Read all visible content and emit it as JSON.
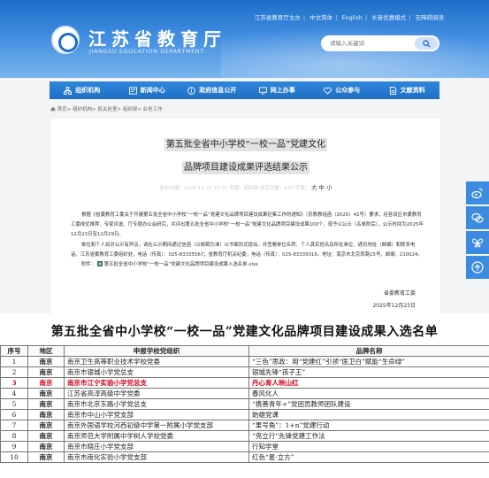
{
  "header": {
    "top_links": [
      "江苏省教育厅主办",
      "中文简体",
      "English",
      "长者优惠模式",
      "无障碍阅读"
    ],
    "site_title": "江苏省教育厅",
    "site_subtitle": "JIANGSU EDUCATION DEPARTMENT",
    "search_placeholder": "请输入关键词"
  },
  "nav": {
    "items": [
      {
        "label": "组织机构",
        "icon": "org-icon"
      },
      {
        "label": "新闻中心",
        "icon": "news-icon"
      },
      {
        "label": "政府信息公开",
        "icon": "info-icon"
      },
      {
        "label": "网上办事",
        "icon": "monitor-icon"
      },
      {
        "label": "公众参与",
        "icon": "heart-icon"
      },
      {
        "label": "文献资料",
        "icon": "document-icon"
      }
    ]
  },
  "breadcrumb": "首页> 组织机构> 机关处室> 组织部> 业务工作",
  "article": {
    "title_line1": "第五批全省中小学校“一校一品”党建文化",
    "title_line2": "品牌项目建设成果评选结果公示",
    "meta_text": "发布日期：2025-12-23 15:01    来源：组织部    浏览次数：643    字体：",
    "font_size_label": "大 中 小",
    "para1": "根据《省委教育工委关于开展第五批全省中小学校“一校一品”党建文化品牌项目建设成果征集工作的通知》（苏教教组函〔2025〕41号）要求，经各设区市委教育工委择优推荐、专家评选、厅专题办公会研究，共评出第五批全省中小学校“一校一品”党建文化品牌项目建设成果100个，现予以公示（名单附后），公示时间为2025年12月23日至12月29日。",
    "para2": "单位和个人如对公示有异议，请在公示期间通过信函（以邮戳为准）以书面形式提出。并签署单位名称、个人真实姓名及所在单位、通讯地址（邮编）和联系电话。江苏省委教育工委组织处，电话（传真）：025-83335567；省教育厅机关纪委，电话（传真）：025-83335016。地址：南京市北京西路15号，邮编：210024。",
    "attachment_prefix": "附件：",
    "attachment_name": "第五批全省中小学校“一校一品”党建文化品牌项目建设成果入选名单.xlsx",
    "signature_org": "省委教育工委",
    "signature_date": "2025年12月23日"
  },
  "float_bar": [
    "weibo-icon",
    "wechat-icon",
    "butterfly-icon",
    "back-to-top-icon"
  ],
  "table": {
    "title": "第五批全省中小学校“一校一品”党建文化品牌项目建设成果入选名单",
    "headers": [
      "序号",
      "地区",
      "申报学校党组织",
      "品牌名称"
    ],
    "rows": [
      {
        "no": "1",
        "region": "南京",
        "org": "南京卫生高等职业技术学校党委",
        "brand": "“三色”思政：用“党建红”引领“医卫白”赋能“生命绿”",
        "highlight": false
      },
      {
        "no": "2",
        "region": "南京",
        "org": "南京市银城小学党总支",
        "brand": "银城先锋“孩子王”",
        "highlight": false
      },
      {
        "no": "3",
        "region": "南京",
        "org": "南京市江宁实验小学党总支",
        "brand": "丹心育人映山红",
        "highlight": true
      },
      {
        "no": "4",
        "region": "南京",
        "org": "江苏省高淳高级中学党委",
        "brand": "春风化人",
        "highlight": false
      },
      {
        "no": "5",
        "region": "南京",
        "org": "南京市北京东路小学党总支",
        "brand": "“携善青年+”党团员教师团队建设",
        "highlight": false
      },
      {
        "no": "6",
        "region": "南京",
        "org": "南京市中山小学党支部",
        "brand": "始雄党课",
        "highlight": false
      },
      {
        "no": "7",
        "region": "南京",
        "org": "南京外国语学校河西初级中学第一附属小学党支部",
        "brand": "“果号角”：1+n”党建行动",
        "highlight": false
      },
      {
        "no": "8",
        "region": "南京",
        "org": "南京师范大学附属中学树人学校党委",
        "brand": "“亮立行”先锋党建工作法",
        "highlight": false
      },
      {
        "no": "9",
        "region": "南京",
        "org": "南京市晓庄小学党支部",
        "brand": "行知学堂",
        "highlight": false
      },
      {
        "no": "10",
        "region": "南京",
        "org": "南京市南化实验小学党支部",
        "brand": "红色“星·立方”",
        "highlight": false
      }
    ]
  },
  "colors": {
    "brand_blue": "#1e6fc8",
    "nav_blue": "#2f86dc",
    "highlight_red": "#d0021b"
  }
}
